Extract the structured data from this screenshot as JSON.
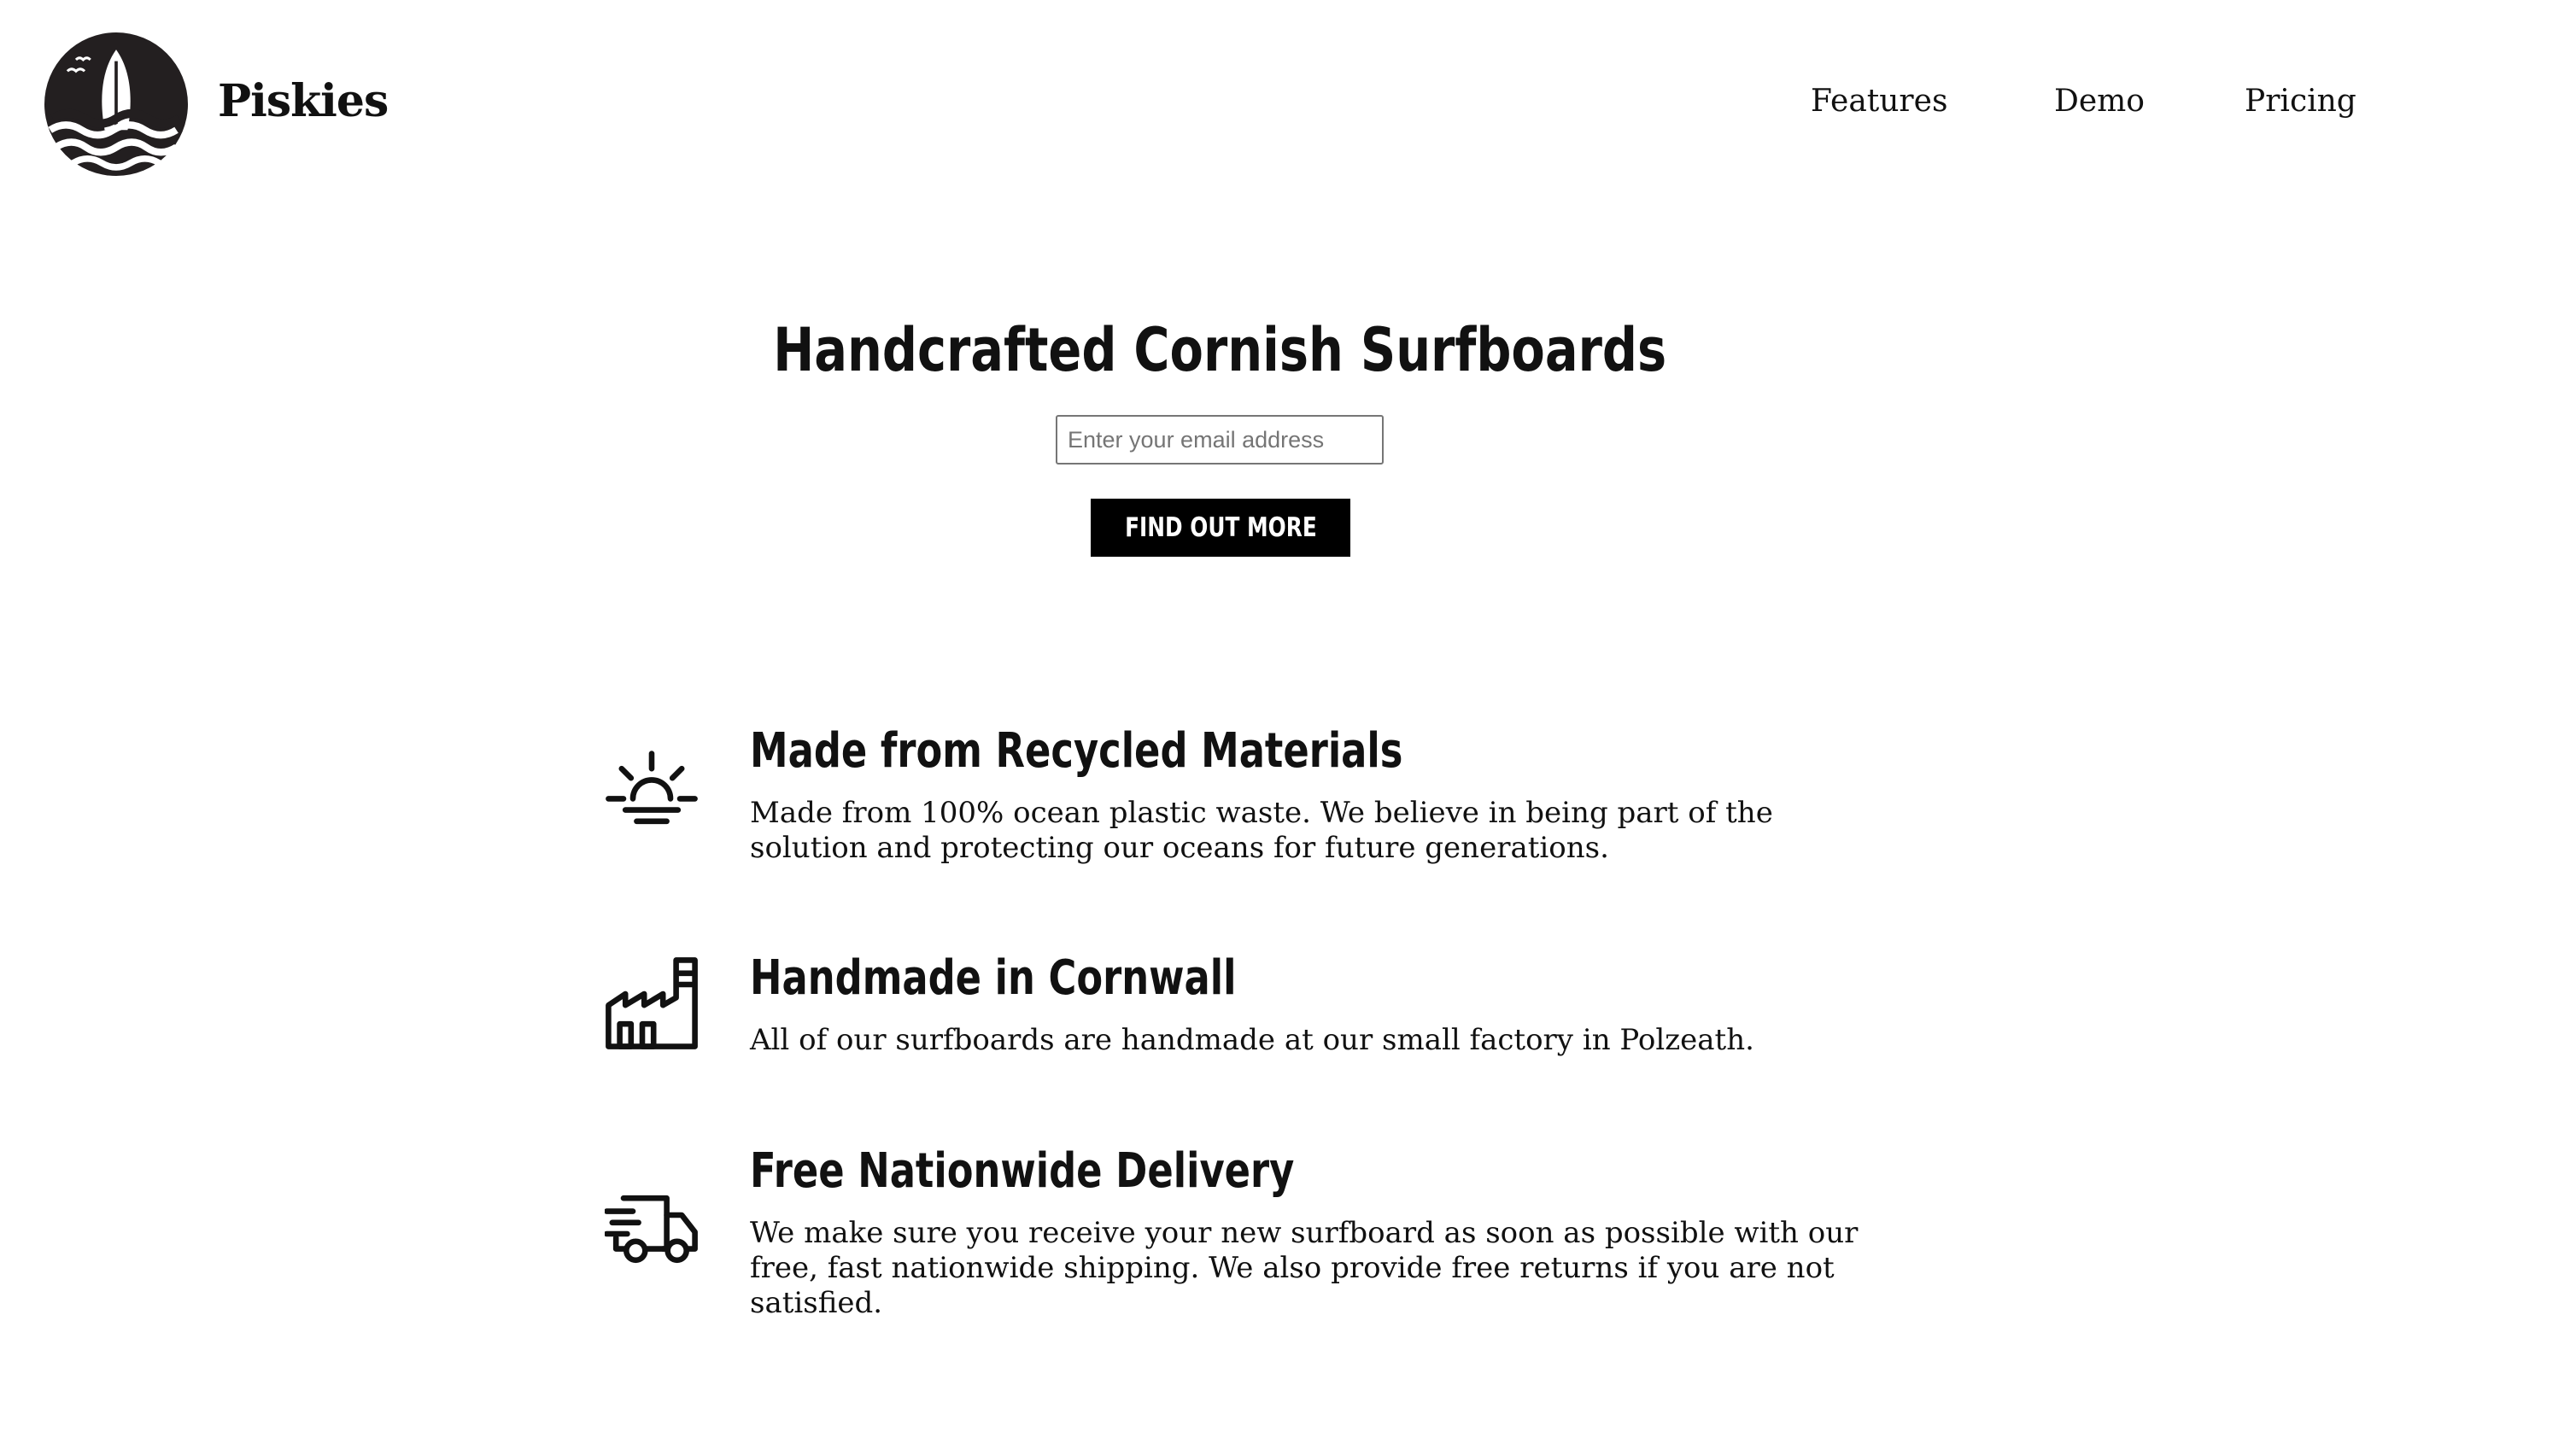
{
  "header": {
    "logo_icon": "surfboard-sunset-logo",
    "brand": "Piskies",
    "nav": [
      {
        "label": "Features"
      },
      {
        "label": "Demo"
      },
      {
        "label": "Pricing"
      }
    ]
  },
  "hero": {
    "title": "Handcrafted Cornish Surfboards",
    "email_placeholder": "Enter your email address",
    "email_value": "",
    "cta_label": "FIND OUT MORE"
  },
  "features": [
    {
      "icon": "sunrise-icon",
      "title": "Made from Recycled Materials",
      "text": "Made from 100% ocean plastic waste. We believe in being part of the solution and protecting our oceans for future generations."
    },
    {
      "icon": "factory-icon",
      "title": "Handmade in Cornwall",
      "text": "All of our surfboards are handmade at our small factory in Polzeath."
    },
    {
      "icon": "delivery-truck-icon",
      "title": "Free Nationwide Delivery",
      "text": "We make sure you receive your new surfboard as soon as possible with our free, fast nationwide shipping. We also provide free returns if you are not satisfied."
    }
  ],
  "colors": {
    "text": "#111111",
    "background": "#ffffff",
    "button_bg": "#000000",
    "button_text": "#ffffff"
  }
}
